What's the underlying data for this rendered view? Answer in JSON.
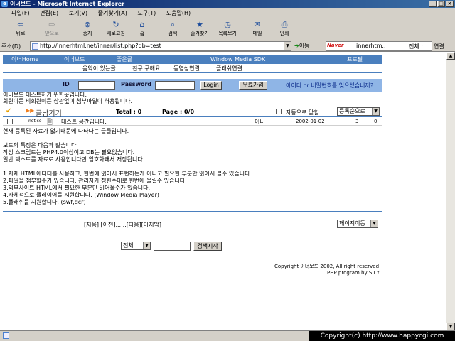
{
  "window": {
    "title": "이너보드 - Microsoft Internet Explorer"
  },
  "menubar": {
    "items": [
      "파일(F)",
      "편집(E)",
      "보기(V)",
      "즐겨찾기(A)",
      "도구(T)",
      "도움말(H)"
    ]
  },
  "toolbar": {
    "back": "뒤로",
    "forward": "앞으로",
    "stop": "중지",
    "refresh": "새로고침",
    "home": "홈",
    "search": "검색",
    "favorites": "즐겨찾기",
    "history": "목록보기",
    "mail": "메일",
    "print": "인쇄"
  },
  "addressbar": {
    "label": "주소(D)",
    "url": "http://innerhtml.net/inner/list.php?db=test",
    "go": "이동",
    "nav_query": "innerhtm..",
    "nav_right": "전체 :",
    "links": "연결"
  },
  "board": {
    "topnav": [
      "이너Home",
      "이너보드",
      "좋은글",
      "Window Media SDK",
      "프로필"
    ],
    "subnav": [
      "음악이 있는글",
      "친구 구해요",
      "동영상연결",
      "플래쉬연결"
    ],
    "login": {
      "id_label": "ID",
      "pw_label": "Password",
      "login_button": "Login",
      "join_button": "무료가입",
      "forgot": "아이디 or 비밀번호를 잊으셨습니까?"
    },
    "desc": [
      "이너보드 테스트하기 위한곳입니다.",
      "회원이든 비회원이든 상관없이 첨부파일이 허용됩니다."
    ],
    "listhead": {
      "write": "글남기기",
      "total": "Total : 0",
      "page": "Page : 0/0",
      "auto_close": "자동으로 닫힘",
      "sort": "등록순으로"
    },
    "row": {
      "notice": "notice",
      "title": "테스트 공간입니다.",
      "author": "이너",
      "date": "2002-01-02",
      "hits": "3",
      "votes": "0"
    },
    "body_lines": [
      "현재 등록된 자료가 없기때문에 나타나는 글들입니다.",
      "",
      "보드의 특징은 다음과 같습니다.",
      "작성 스크립트는 PHP4.0이상이고 DB는 필요없습니다.",
      "일반 텍스트를 자료로 사용합니다만 암호화돼서 저장됩니다.",
      "",
      "1.자체 HTML에디터를 사용하고, 한번에 읽어서 표현하는게 아니고 필요한 부분만 읽어서 볼수 있습니다.",
      "2.파일을 첨부할수가 있습니다. 관리자가 정한수대로 한번에 올릴수 있습니다.",
      "3.외부사이트 HTML에서 필요한 부분만 읽어올수가 있습니다.",
      "4.자체적으로 플레이어를 지원합니다. (Window Media Player)",
      "5.플래쉬를 지원합니다. (swf,dcr)"
    ],
    "pager": "[처음] [이전]......[다음][마지막]",
    "page_move": "페이지이동",
    "search_scope": "전체",
    "search_button": "검색시작",
    "copyright_line1": "Copyright 이너보드 2002, All right reserved",
    "copyright_line2": "PHP program by S.I.Y"
  },
  "statusbar": {
    "copyright": "Copyright(c) http://www.happycgi.com"
  }
}
